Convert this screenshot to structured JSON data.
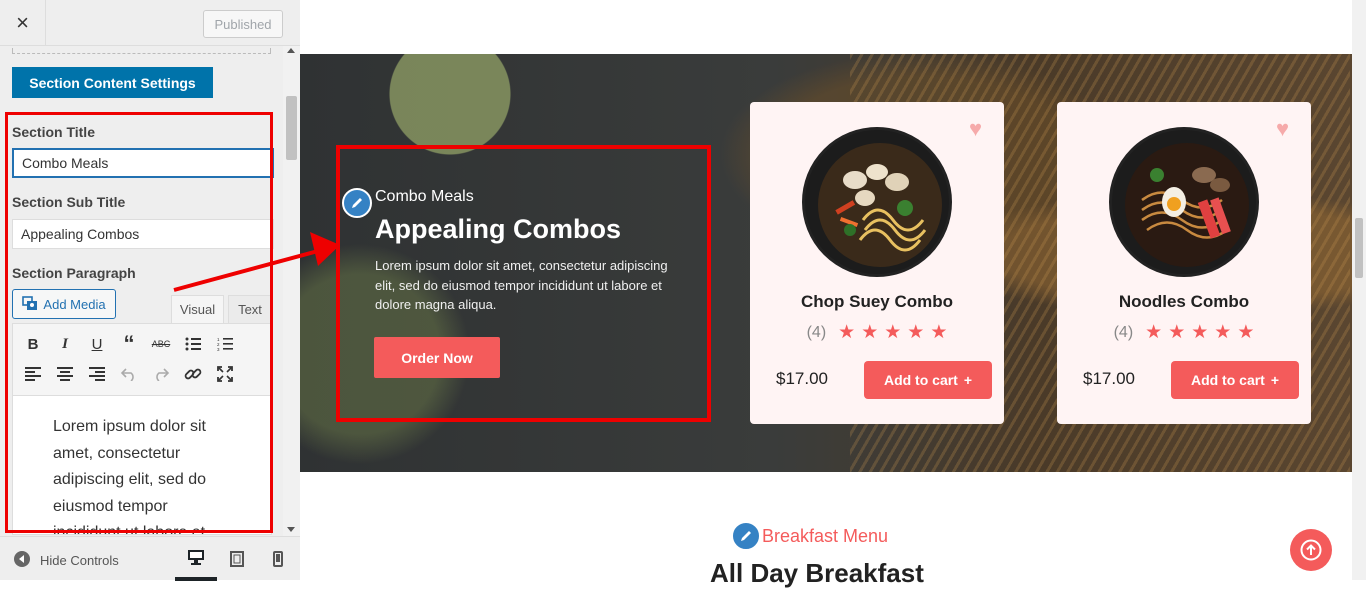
{
  "topbar": {
    "close_icon": "×",
    "published_label": "Published"
  },
  "section_settings_label": "Section Content Settings",
  "fields": {
    "title_label": "Section Title",
    "title_value": "Combo Meals",
    "subtitle_label": "Section Sub Title",
    "subtitle_value": "Appealing Combos",
    "paragraph_label": "Section Paragraph"
  },
  "editor": {
    "add_media_label": "Add Media",
    "tab_visual": "Visual",
    "tab_text": "Text",
    "content": "Lorem ipsum dolor sit amet, consectetur adipiscing elit, sed do eiusmod tempor incididunt ut labore et"
  },
  "bottombar": {
    "hide_controls_label": "Hide Controls"
  },
  "hero": {
    "subtitle": "Combo Meals",
    "title": "Appealing Combos",
    "paragraph": "Lorem ipsum dolor sit amet, consectetur adipiscing elit, sed do eiusmod tempor incididunt ut labore et dolore magna aliqua.",
    "button_label": "Order Now"
  },
  "products": [
    {
      "name": "Chop Suey Combo",
      "rating_count": "(4)",
      "stars": 5,
      "price": "$17.00",
      "cart_label": "Add to cart"
    },
    {
      "name": "Noodles Combo",
      "rating_count": "(4)",
      "stars": 5,
      "price": "$17.00",
      "cart_label": "Add to cart"
    }
  ],
  "next_section": {
    "subtitle": "Breakfast Menu",
    "title": "All Day Breakfast"
  },
  "colors": {
    "accent": "#f45b5b",
    "wp_blue": "#0073aa",
    "highlight_red": "#ee0000"
  }
}
